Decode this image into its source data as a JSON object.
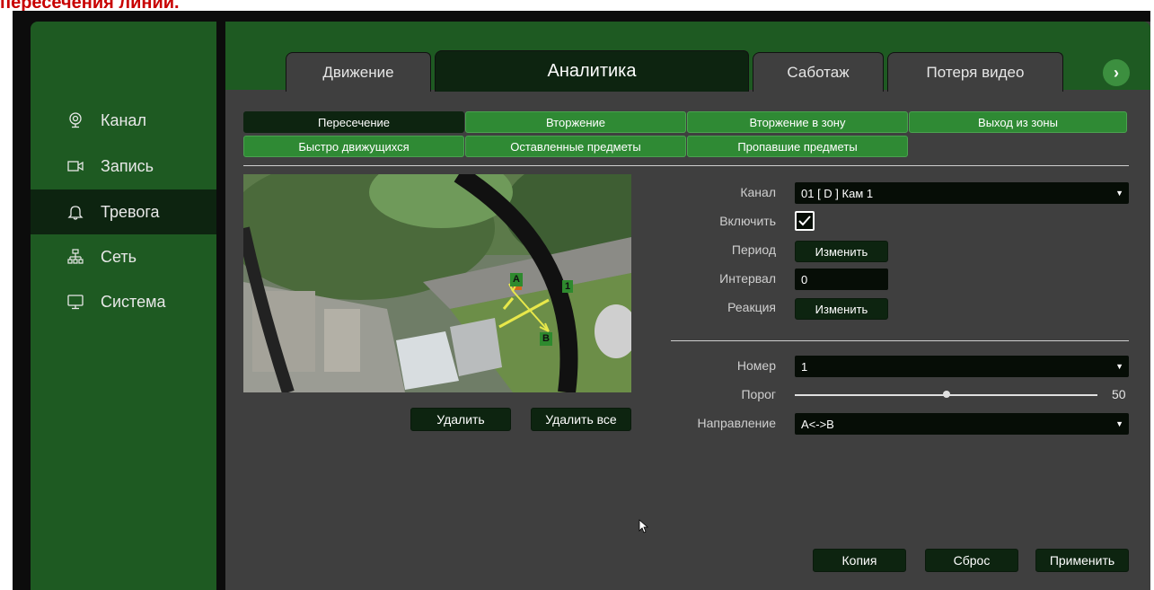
{
  "header_caption": "пересечения линии.",
  "sidebar": {
    "items": [
      {
        "label": "Канал",
        "icon": "camera-lens-icon"
      },
      {
        "label": "Запись",
        "icon": "video-record-icon"
      },
      {
        "label": "Тревога",
        "icon": "bell-icon",
        "active": true
      },
      {
        "label": "Сеть",
        "icon": "network-icon"
      },
      {
        "label": "Система",
        "icon": "monitor-icon"
      }
    ]
  },
  "tabs": [
    {
      "label": "Движение"
    },
    {
      "label": "Аналитика",
      "active": true
    },
    {
      "label": "Саботаж"
    },
    {
      "label": "Потеря видео"
    }
  ],
  "subtabs": [
    {
      "label": "Пересечение",
      "active": true
    },
    {
      "label": "Вторжение"
    },
    {
      "label": "Вторжение в зону"
    },
    {
      "label": "Выход из зоны"
    },
    {
      "label": "Быстро движущихся"
    },
    {
      "label": "Оставленные предметы"
    },
    {
      "label": "Пропавшие предметы"
    }
  ],
  "preview": {
    "marker_a": "A",
    "marker_b": "B",
    "marker_1": "1"
  },
  "preview_buttons": {
    "delete": "Удалить",
    "delete_all": "Удалить все"
  },
  "form": {
    "channel_label": "Канал",
    "channel_value": "01 [ D ] Кам 1",
    "enable_label": "Включить",
    "enable_checked": true,
    "period_label": "Период",
    "period_button": "Изменить",
    "interval_label": "Интервал",
    "interval_value": "0",
    "reaction_label": "Реакция",
    "reaction_button": "Изменить",
    "number_label": "Номер",
    "number_value": "1",
    "threshold_label": "Порог",
    "threshold_value": "50",
    "threshold_fraction": 0.5,
    "direction_label": "Направление",
    "direction_value": "A<->B"
  },
  "footer": {
    "copy": "Копия",
    "reset": "Сброс",
    "apply": "Применить"
  },
  "colors": {
    "sidebar_green": "#1e5a22",
    "active_dark": "#0d2410",
    "subtab_green": "#2f8a34",
    "panel_gray": "#3f3f3f",
    "caption_red": "#c80000"
  }
}
